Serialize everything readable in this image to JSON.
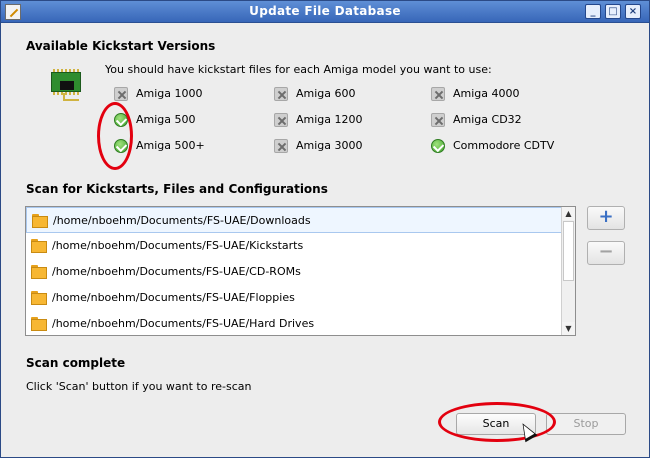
{
  "window": {
    "title": "Update File Database",
    "controls": [
      "minimize-icon",
      "maximize-icon",
      "close-icon"
    ]
  },
  "kickstart": {
    "heading": "Available Kickstart Versions",
    "instruction": "You should have kickstart files for each Amiga model you want to use:",
    "models": [
      {
        "label": "Amiga 1000",
        "available": false
      },
      {
        "label": "Amiga 600",
        "available": false
      },
      {
        "label": "Amiga 4000",
        "available": false
      },
      {
        "label": "Amiga 500",
        "available": true
      },
      {
        "label": "Amiga 1200",
        "available": false
      },
      {
        "label": "Amiga CD32",
        "available": false
      },
      {
        "label": "Amiga 500+",
        "available": true
      },
      {
        "label": "Amiga 3000",
        "available": false
      },
      {
        "label": "Commodore CDTV",
        "available": true
      }
    ]
  },
  "scan": {
    "heading": "Scan for Kickstarts, Files and Configurations",
    "folders": [
      "/home/nboehm/Documents/FS-UAE/Downloads",
      "/home/nboehm/Documents/FS-UAE/Kickstarts",
      "/home/nboehm/Documents/FS-UAE/CD-ROMs",
      "/home/nboehm/Documents/FS-UAE/Floppies",
      "/home/nboehm/Documents/FS-UAE/Hard Drives"
    ],
    "add_label": "+",
    "remove_label": "−"
  },
  "status": {
    "heading": "Scan complete",
    "message": "Click 'Scan' button if you want to re-scan"
  },
  "buttons": {
    "scan": "Scan",
    "stop": "Stop"
  },
  "colors": {
    "titlebar": "#3766b8",
    "annotation": "#e3000f",
    "ok_icon": "#3f9f2d"
  }
}
